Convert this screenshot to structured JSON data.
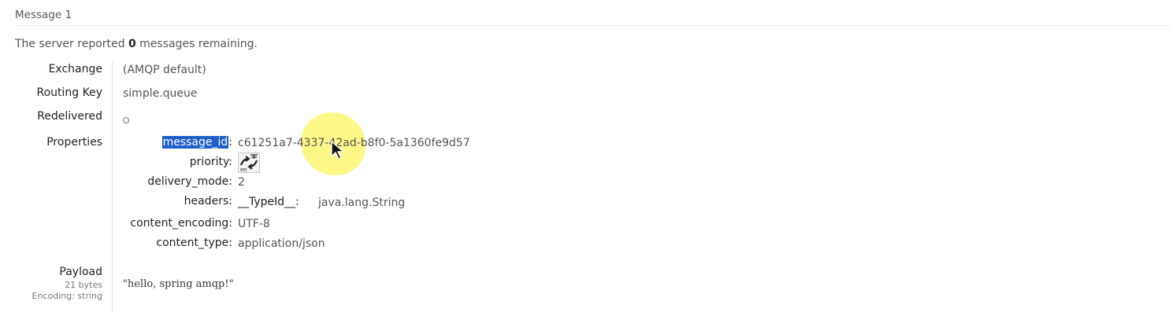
{
  "section": {
    "title": "Message 1"
  },
  "report": {
    "prefix": "The server reported ",
    "count": "0",
    "suffix": " messages remaining."
  },
  "fields": {
    "exchange_label": "Exchange",
    "exchange_value": "(AMQP default)",
    "routing_key_label": "Routing Key",
    "routing_key_value": "simple.queue",
    "redelivered_label": "Redelivered",
    "redelivered_value": "○",
    "properties_label": "Properties",
    "payload_label": "Payload",
    "payload_size": "21 bytes",
    "payload_encoding": "Encoding: string",
    "payload_value": "\"hello, spring amqp!\""
  },
  "properties": {
    "message_id_key": "message_id",
    "message_id_colon": ":",
    "message_id_value": "c61251a7-4337-42ad-b8f0-5a1360fe9d57",
    "priority_key": "priority:",
    "delivery_mode_key": "delivery_mode:",
    "delivery_mode_value": "2",
    "headers_key": "headers:",
    "headers_subkey": "__TypeId__:",
    "headers_subvalue": "java.lang.String",
    "content_encoding_key": "content_encoding:",
    "content_encoding_value": "UTF-8",
    "content_type_key": "content_type:",
    "content_type_value": "application/json"
  },
  "icons": {
    "priority_icon": "translate-icon",
    "cursor_icon": "mouse-pointer-icon"
  },
  "colors": {
    "selection": "#1f5fc8",
    "highlight": "#fbf772"
  }
}
